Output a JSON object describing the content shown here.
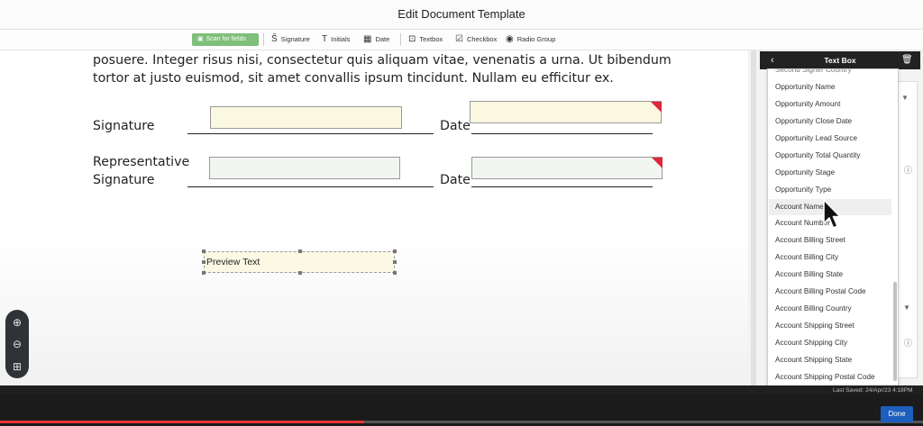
{
  "window": {
    "title": "Edit Document Template"
  },
  "toolbar": {
    "scan_label": "Scan for fields",
    "tools": [
      {
        "label": "Signature",
        "icon": "signature-icon"
      },
      {
        "label": "Initials",
        "icon": "initials-icon"
      },
      {
        "label": "Date",
        "icon": "calendar-icon"
      },
      {
        "label": "Textbox",
        "icon": "textbox-icon"
      },
      {
        "label": "Checkbox",
        "icon": "checkbox-icon"
      },
      {
        "label": "Radio Group",
        "icon": "radio-icon"
      }
    ]
  },
  "document": {
    "paragraph": "posuere. Integer risus nisi, consectetur quis aliquam vitae, venenatis a urna. Ut bibendum tortor at justo euismod, sit amet convallis ipsum tincidunt. Nullam eu efficitur ex.",
    "signature_label": "Signature",
    "date_label": "Date",
    "rep_signature_label_1": "Representative",
    "rep_signature_label_2": "Signature",
    "date_label_2": "Date",
    "preview_text": "Preview Text"
  },
  "panel": {
    "title": "Text Box",
    "cut_off_item": "Second Signer Country",
    "options": [
      "Opportunity Name",
      "Opportunity Amount",
      "Opportunity Close Date",
      "Opportunity Lead Source",
      "Opportunity Total Quantity",
      "Opportunity Stage",
      "Opportunity Type",
      "Account Name",
      "Account Number",
      "Account Billing Street",
      "Account Billing City",
      "Account Billing State",
      "Account Billing Postal Code",
      "Account Billing Country",
      "Account Shipping Street",
      "Account Shipping City",
      "Account Shipping State",
      "Account Shipping Postal Code"
    ],
    "highlighted_option": "Account Name"
  },
  "footer": {
    "last_saved": "Last Saved: 24/Apr/23 4:18PM",
    "done_label": "Done",
    "playback_progress": 0.395
  },
  "colors": {
    "scan_button": "#7fbf7a",
    "panel_header": "#222222",
    "done_button": "#1d5fbf",
    "field_marker": "#e0263a",
    "progress": "#ee3333"
  }
}
